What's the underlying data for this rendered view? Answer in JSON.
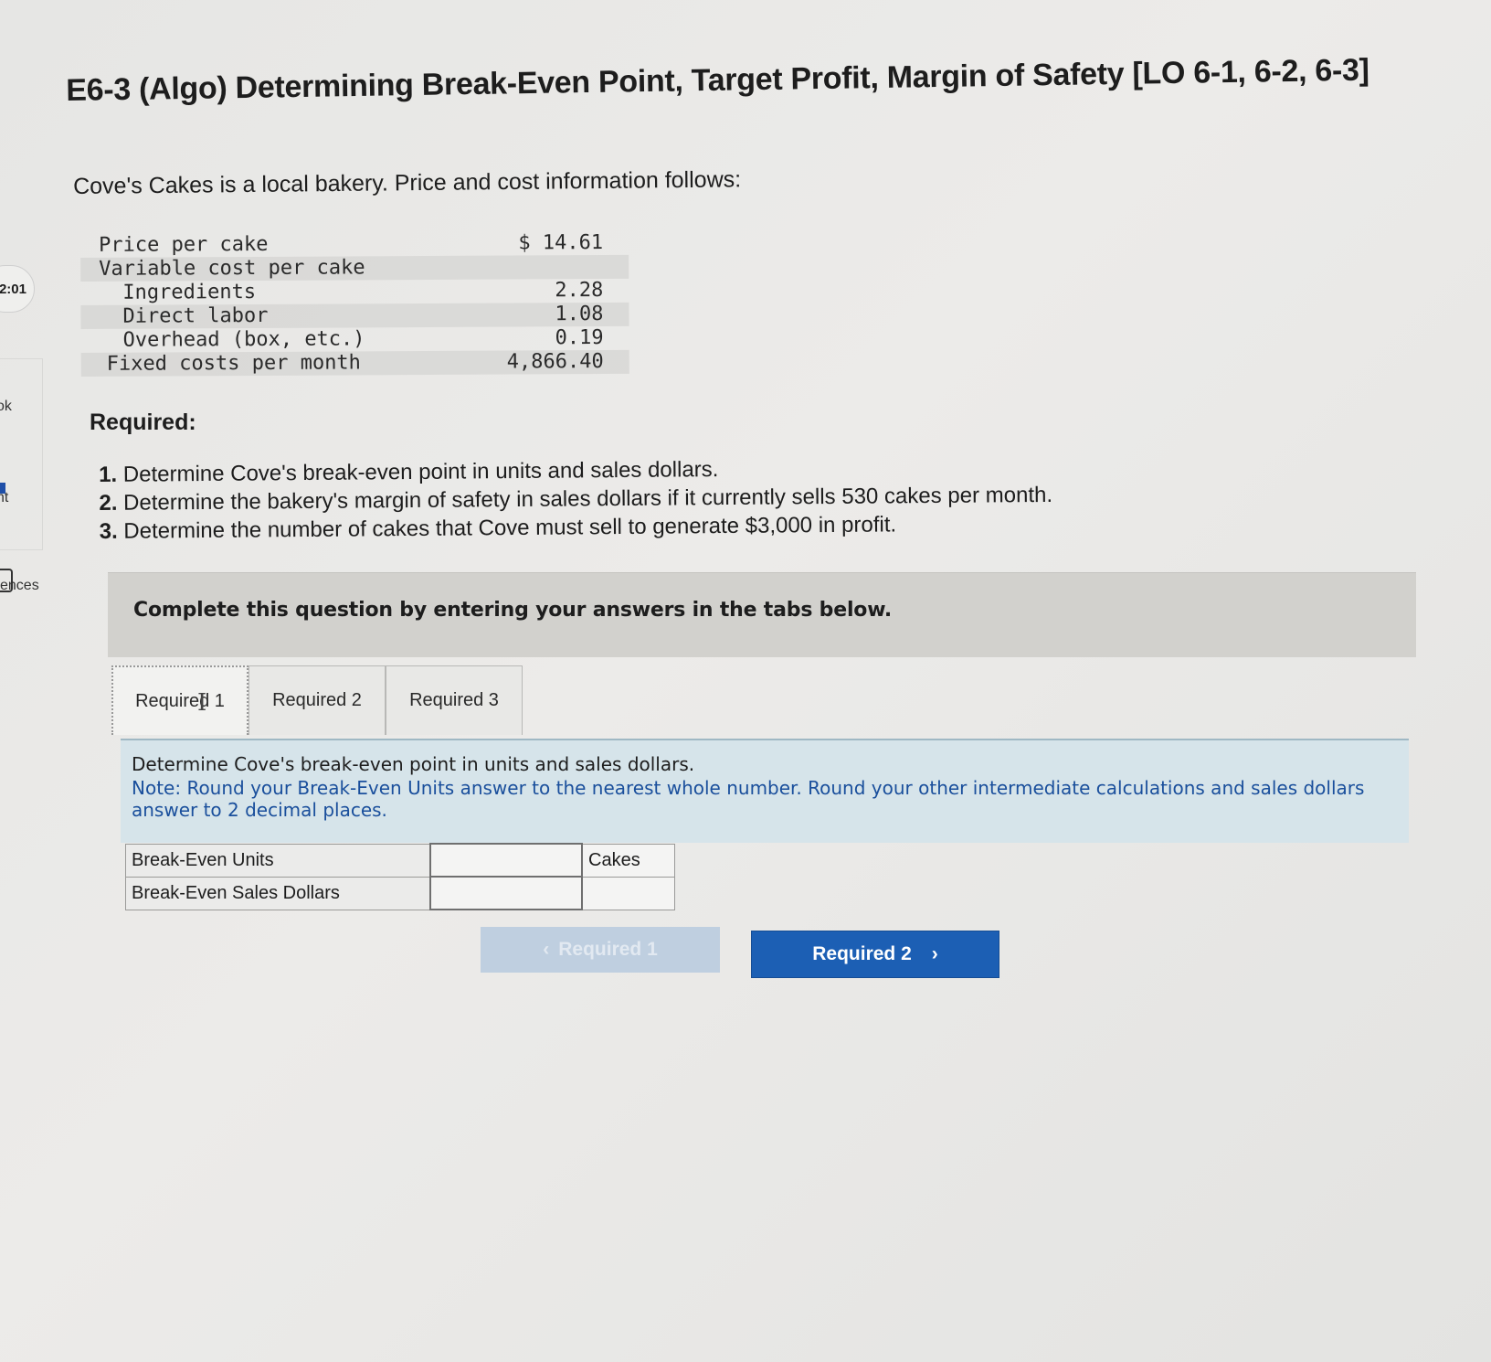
{
  "sidebar": {
    "timer": "2:01",
    "label_1": "ok",
    "label_2": "nt",
    "label_3": "ences"
  },
  "title": "E6-3 (Algo) Determining Break-Even Point, Target Profit, Margin of Safety [LO 6-1, 6-2, 6-3]",
  "intro": "Cove's Cakes is a local bakery. Price and cost information follows:",
  "cost_table": [
    {
      "label": "Price per cake",
      "value": "$ 14.61"
    },
    {
      "label": "Variable cost per cake",
      "value": ""
    },
    {
      "label": "Ingredients",
      "value": "2.28"
    },
    {
      "label": "Direct labor",
      "value": "1.08"
    },
    {
      "label": "Overhead (box, etc.)",
      "value": "0.19"
    },
    {
      "label": "Fixed costs per month",
      "value": "4,866.40"
    }
  ],
  "required": {
    "heading": "Required:",
    "items": [
      {
        "num": "1.",
        "text": "Determine Cove's break-even point in units and sales dollars."
      },
      {
        "num": "2.",
        "text": "Determine the bakery's margin of safety in sales dollars if it currently sells 530 cakes per month."
      },
      {
        "num": "3.",
        "text": "Determine the number of cakes that Cove must sell to generate $3,000 in profit."
      }
    ]
  },
  "banner": "Complete this question by entering your answers in the tabs below.",
  "tabs": [
    "Required 1",
    "Required 2",
    "Required 3"
  ],
  "active_tab": "Required 1",
  "instructions": {
    "main": "Determine Cove's break-even point in units and sales dollars.",
    "note": "Note: Round your Break-Even Units answer to the nearest whole number. Round your other intermediate calculations and sales dollars answer to 2 decimal places."
  },
  "answers": [
    {
      "label": "Break-Even Units",
      "value": "",
      "unit": "Cakes"
    },
    {
      "label": "Break-Even Sales Dollars",
      "value": "",
      "unit": ""
    }
  ],
  "nav": {
    "prev_label": "Required 1",
    "next_label": "Required 2",
    "prev_icon": "chevron-left-icon",
    "next_icon": "chevron-right-icon"
  }
}
